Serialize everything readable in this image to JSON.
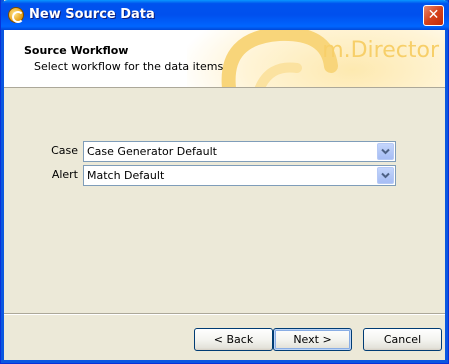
{
  "window": {
    "title": "New Source Data",
    "close_glyph": "✕"
  },
  "header": {
    "title": "Source Workflow",
    "subtitle": "Select workflow for the data items",
    "brand": "m.Director"
  },
  "form": {
    "case": {
      "label": "Case",
      "value": "Case Generator Default"
    },
    "alert": {
      "label": "Alert",
      "value": "Match Default"
    }
  },
  "buttons": {
    "back": "< Back",
    "next": "Next >",
    "cancel": "Cancel"
  },
  "colors": {
    "titlebar": "#0053ee",
    "face": "#ece9d8",
    "close": "#d5421c",
    "brand": "#f7cf69"
  },
  "icons": {
    "title": "app-swirl-icon",
    "dropdown": "chevron-down-icon"
  }
}
